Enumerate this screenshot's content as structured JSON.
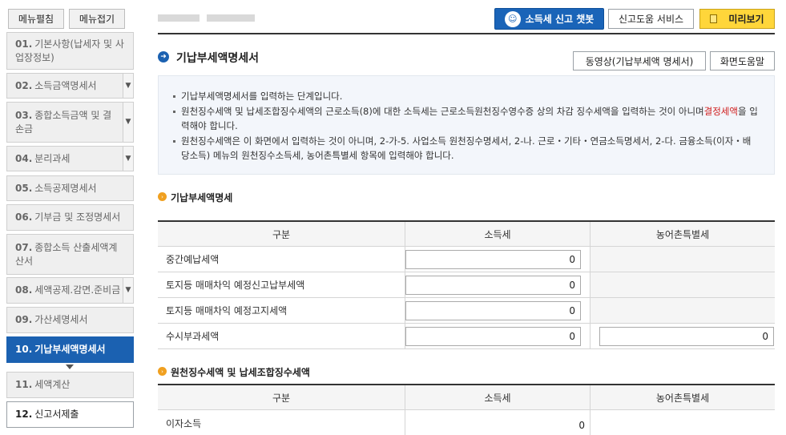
{
  "sidebar": {
    "expand_label": "메뉴펼침",
    "collapse_label": "메뉴접기",
    "items": [
      {
        "num": "01.",
        "label": "기본사항(납세자 및 사업장정보)"
      },
      {
        "num": "02.",
        "label": "소득금액명세서"
      },
      {
        "num": "03.",
        "label": "종합소득금액 및 결손금"
      },
      {
        "num": "04.",
        "label": "분리과세"
      },
      {
        "num": "05.",
        "label": "소득공제명세서"
      },
      {
        "num": "06.",
        "label": "기부금 및 조정명세서"
      },
      {
        "num": "07.",
        "label": "종합소득 산출세액계산서"
      },
      {
        "num": "08.",
        "label": "세액공제.감면.준비금"
      },
      {
        "num": "09.",
        "label": "가산세명세서"
      },
      {
        "num": "10.",
        "label": "기납부세액명세서"
      },
      {
        "num": "11.",
        "label": "세액계산"
      },
      {
        "num": "12.",
        "label": "신고서제출"
      }
    ]
  },
  "topbar": {
    "chatbot_label": "소득세 신고 챗봇",
    "help_service_label": "신고도움 서비스",
    "preview_label": "미리보기"
  },
  "page": {
    "title": "기납부세액명세서",
    "video_button": "동영상(기납부세액 명세서)",
    "help_button": "화면도움말"
  },
  "info": {
    "line1": "기납부세액명세서를 입력하는 단계입니다.",
    "line2_a": "원천징수세액 및 납세조합징수세액의 근로소득(8)에 대한 소득세는 근로소득원천징수영수증 상의 차감 징수세액을 입력하는 것이 아니며",
    "line2_red": "결정세액",
    "line2_b": "을 입력해야 합니다.",
    "line3": "원천징수세액은 이 화면에서 입력하는 것이 아니며, 2-가-5. 사업소득 원천징수명세서, 2-나. 근로・기타・연금소득명세서, 2-다. 금융소득(이자・배당소득) 메뉴의 원천징수소득세, 농어촌특별세 항목에 입력해야 합니다."
  },
  "section1": {
    "title": "기납부세액명세",
    "headers": [
      "구분",
      "소득세",
      "농어촌특별세"
    ],
    "rows": [
      {
        "label": "중간예납세액",
        "income_tax": "0"
      },
      {
        "label": "토지등 매매차익 예정신고납부세액",
        "income_tax": "0"
      },
      {
        "label": "토지등 매매차익 예정고지세액",
        "income_tax": "0"
      },
      {
        "label": "수시부과세액",
        "income_tax": "0",
        "rural_tax": "0"
      }
    ]
  },
  "section2": {
    "title": "원천징수세액 및 납세조합징수세액",
    "headers": [
      "구분",
      "소득세",
      "농어촌특별세"
    ],
    "rows": [
      {
        "label": "이자소득",
        "income_tax": "0"
      }
    ]
  }
}
